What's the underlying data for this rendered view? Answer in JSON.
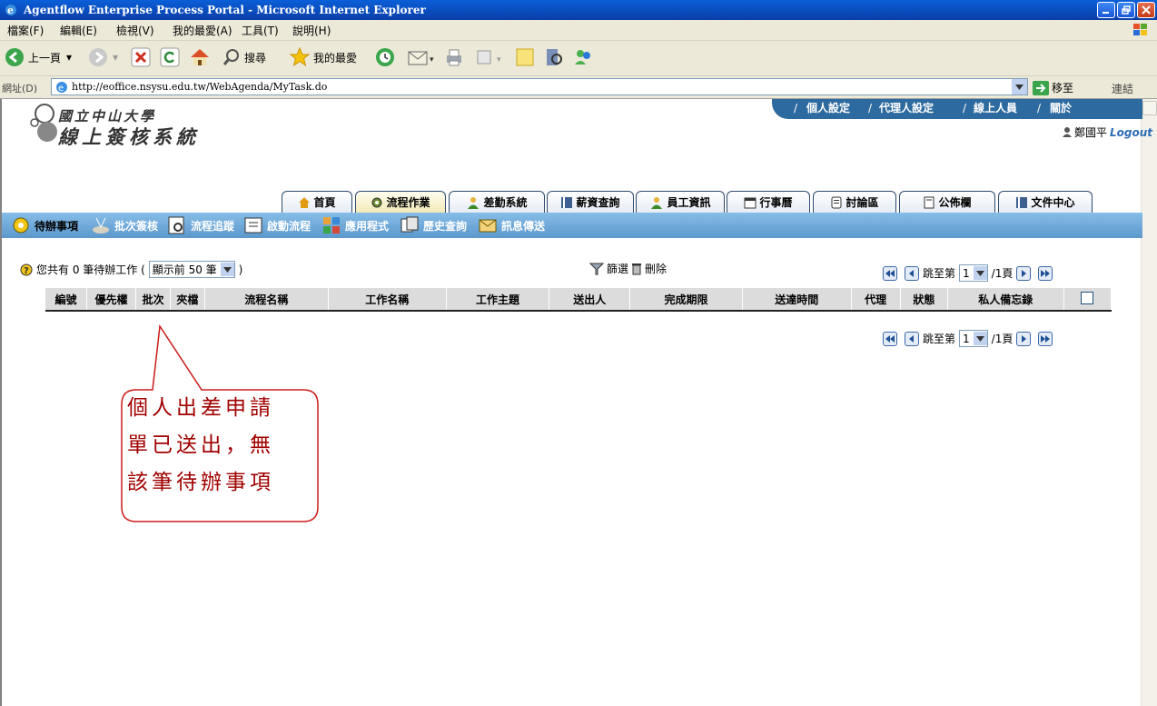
{
  "window": {
    "title": "Agentflow Enterprise Process Portal - Microsoft Internet Explorer"
  },
  "menubar": {
    "items": [
      "檔案(F)",
      "編輯(E)",
      "檢視(V)",
      "我的最愛(A)",
      "工具(T)",
      "說明(H)"
    ]
  },
  "toolbar": {
    "back": "上一頁",
    "search": "搜尋",
    "favorites": "我的最愛"
  },
  "address": {
    "label": "網址(D)",
    "url": "http://eoffice.nsysu.edu.tw/WebAgenda/MyTask.do",
    "go": "移至",
    "links": "連結"
  },
  "header": {
    "top_links": [
      "個人設定",
      "代理人設定",
      "線上人員",
      "關於"
    ],
    "separator": "/",
    "logo_line1": "國立中山大學",
    "logo_line2": "線上簽核系統",
    "user_name": "鄭國平",
    "logout": "Logout"
  },
  "main_tabs": [
    "首頁",
    "流程作業",
    "差勤系統",
    "薪資查詢",
    "員工資訊",
    "行事曆",
    "討論區",
    "公佈欄",
    "文件中心"
  ],
  "sub_nav": [
    "待辦事項",
    "批次簽核",
    "流程追蹤",
    "啟動流程",
    "應用程式",
    "歷史查詢",
    "訊息傳送"
  ],
  "content": {
    "count_prefix": "您共有 0 筆待辦工作 (",
    "count_select": "顯示前 50 筆",
    "count_suffix": ")",
    "filter": "篩選",
    "delete": "刪除",
    "pager_goto": "跳至第",
    "pager_page": "1",
    "pager_total": "/1頁",
    "columns": [
      "編號",
      "優先權",
      "批次",
      "夾檔",
      "流程名稱",
      "工作名稱",
      "工作主題",
      "送出人",
      "完成期限",
      "送達時間",
      "代理",
      "狀態",
      "私人備忘錄"
    ]
  },
  "callout": {
    "lines": [
      "個人出差申請",
      "單已送出，無",
      "該筆待辦事項"
    ]
  },
  "colors": {
    "accent_blue": "#2d6a9f",
    "subnav_blue": "#6ea9d8",
    "callout_text": "#a00000"
  }
}
